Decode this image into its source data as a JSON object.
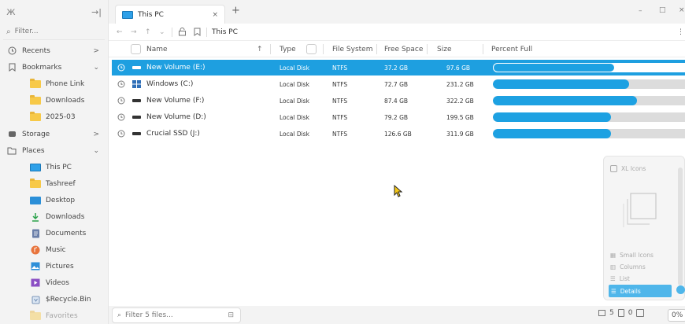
{
  "sidebar": {
    "filter_placeholder": "Filter...",
    "items": [
      {
        "label": "Recents",
        "icon": "clock-icon",
        "arrow": ">"
      },
      {
        "label": "Bookmarks",
        "icon": "bookmark-icon",
        "arrow": "v"
      },
      {
        "label": "Phone Link",
        "icon": "folder-icon"
      },
      {
        "label": "Downloads",
        "icon": "folder-icon"
      },
      {
        "label": "2025-03",
        "icon": "folder-icon"
      },
      {
        "label": "Storage",
        "icon": "drive-icon",
        "arrow": ">"
      },
      {
        "label": "Places",
        "icon": "places-icon",
        "arrow": "v"
      },
      {
        "label": "This PC",
        "icon": "monitor-icon"
      },
      {
        "label": "Tashreef",
        "icon": "folder-icon"
      },
      {
        "label": "Desktop",
        "icon": "desktop-icon"
      },
      {
        "label": "Downloads",
        "icon": "download-icon"
      },
      {
        "label": "Documents",
        "icon": "document-icon"
      },
      {
        "label": "Music",
        "icon": "music-icon"
      },
      {
        "label": "Pictures",
        "icon": "picture-icon"
      },
      {
        "label": "Videos",
        "icon": "video-icon"
      },
      {
        "label": "$Recycle.Bin",
        "icon": "recycle-bin-icon"
      },
      {
        "label": "Favorites",
        "icon": "folder-icon"
      }
    ]
  },
  "tab": {
    "title": "This PC",
    "close": "×",
    "new": "+"
  },
  "window": {
    "minimize": "–",
    "maximize": "□",
    "close": "×"
  },
  "toolbar": {
    "path": "This PC",
    "menu": "⋮"
  },
  "columns": {
    "name": "Name",
    "sort": "↑",
    "type": "Type",
    "filesystem": "File System",
    "free": "Free Space",
    "size": "Size",
    "percent": "Percent Full"
  },
  "rows": [
    {
      "name": "New Volume (E:)",
      "type": "Local Disk",
      "fs": "NTFS",
      "free": "37.2 GB",
      "size": "97.6 GB",
      "percent": 62,
      "selected": true
    },
    {
      "name": "Windows (C:)",
      "type": "Local Disk",
      "fs": "NTFS",
      "free": "72.7 GB",
      "size": "231.2 GB",
      "percent": 69,
      "selected": false
    },
    {
      "name": "New Volume (F:)",
      "type": "Local Disk",
      "fs": "NTFS",
      "free": "87.4 GB",
      "size": "322.2 GB",
      "percent": 73,
      "selected": false
    },
    {
      "name": "New Volume (D:)",
      "type": "Local Disk",
      "fs": "NTFS",
      "free": "79.2 GB",
      "size": "199.5 GB",
      "percent": 60,
      "selected": false
    },
    {
      "name": "Crucial SSD (J:)",
      "type": "Local Disk",
      "fs": "NTFS",
      "free": "126.6 GB",
      "size": "311.9 GB",
      "percent": 60,
      "selected": false
    }
  ],
  "view_panel": {
    "xl": "XL Icons",
    "small": "Small Icons",
    "columns": "Columns",
    "list": "List",
    "details": "Details"
  },
  "status": {
    "filter_placeholder": "Filter 5 files...",
    "count_files": "5",
    "count_folders": "0",
    "zoom": "0%"
  },
  "colors": {
    "accent": "#1e9fe0"
  }
}
